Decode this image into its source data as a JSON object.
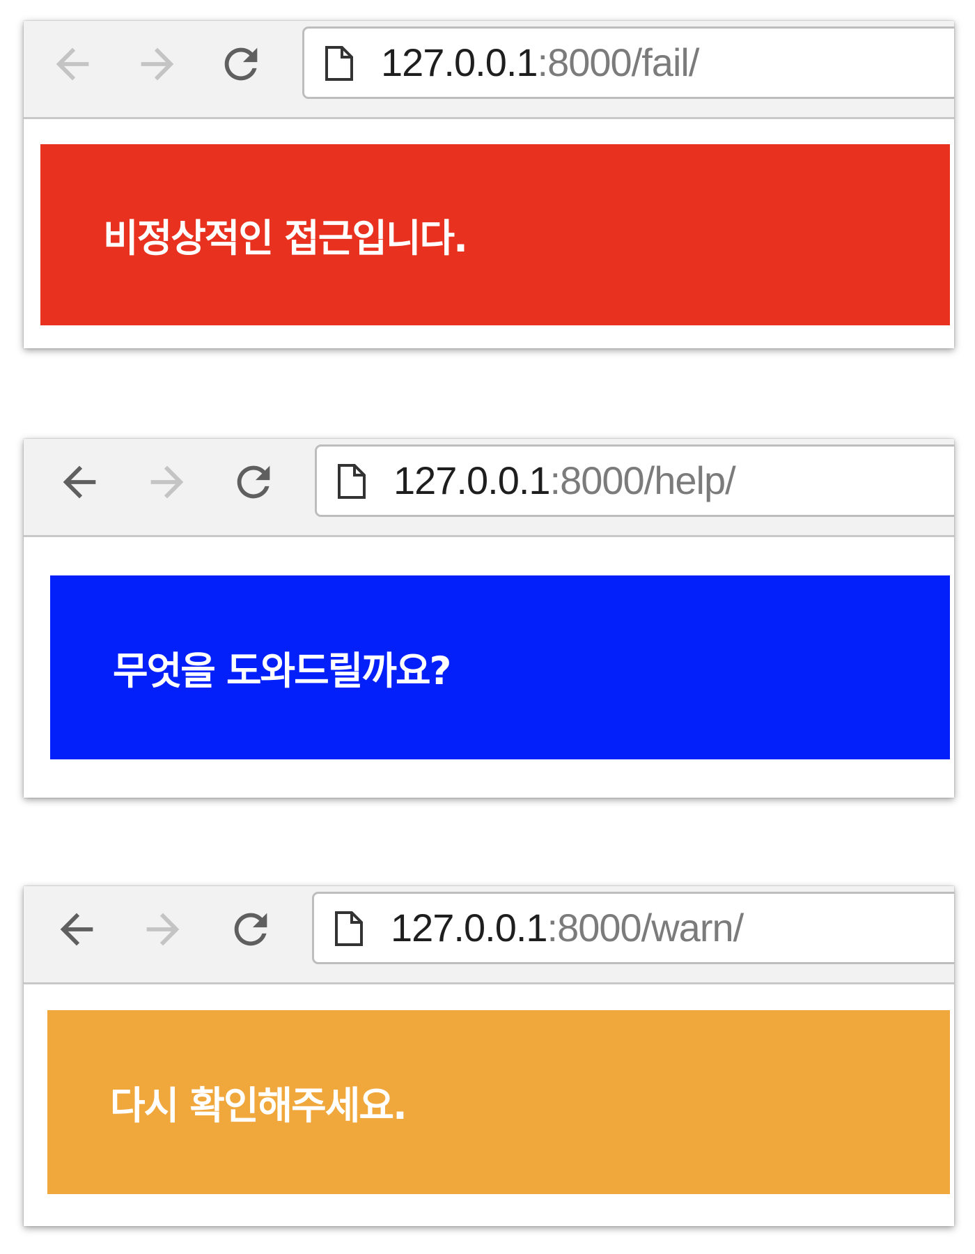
{
  "windows": [
    {
      "url_host": "127.0.0.1",
      "url_rest": ":8000/fail/",
      "back_enabled": false,
      "message": "비정상적인 접근입니다.",
      "alert_color": "#e8321f"
    },
    {
      "url_host": "127.0.0.1",
      "url_rest": ":8000/help/",
      "back_enabled": true,
      "message": "무엇을 도와드릴까요?",
      "alert_color": "#0320fb"
    },
    {
      "url_host": "127.0.0.1",
      "url_rest": ":8000/warn/",
      "back_enabled": true,
      "message": "다시 확인해주세요.",
      "alert_color": "#f0a73b"
    }
  ],
  "icons": {
    "back": "back-arrow-icon",
    "forward": "forward-arrow-icon",
    "reload": "reload-icon",
    "page": "page-icon"
  },
  "colors": {
    "toolbar_bg": "#f2f2f2",
    "icon_enabled": "#5f5f5f",
    "icon_disabled": "#c4c4c4",
    "url_host": "#1e1e1e",
    "url_rest": "#7b7b7b"
  }
}
